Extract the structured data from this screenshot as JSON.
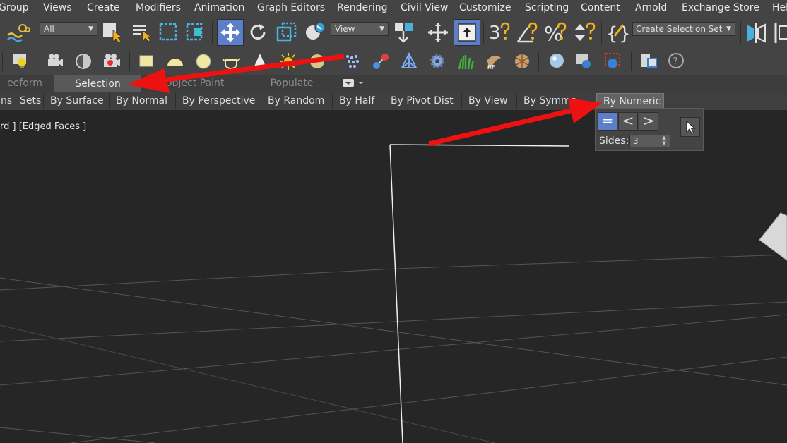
{
  "menu": [
    "Group",
    "Views",
    "Create",
    "Modifiers",
    "Animation",
    "Graph Editors",
    "Rendering",
    "Civil View",
    "Customize",
    "Scripting",
    "Content",
    "Arnold",
    "Exchange Store",
    "Help"
  ],
  "toolbar": {
    "filter_value": "All",
    "refcoord_value": "View",
    "selection_set_placeholder": "Create Selection Set"
  },
  "ribbon_tabs": [
    "eeform",
    "Selection",
    "Object Paint",
    "Populate"
  ],
  "ribbon_buttons": [
    "ns",
    "Sets",
    "By Surface",
    "By Normal",
    "By Perspective",
    "By Random",
    "By Half",
    "By Pivot Dist",
    "By View",
    "By Symme",
    "By Numeric"
  ],
  "viewport": {
    "label": "rd ] [Edged Faces ]"
  },
  "numeric_panel": {
    "sides_label": "Sides:",
    "sides_value": "3",
    "buttons": [
      "=",
      "<",
      ">"
    ]
  },
  "colors": {
    "annotation_arrow": "#ee1111",
    "active_button": "#5b7fc8"
  }
}
